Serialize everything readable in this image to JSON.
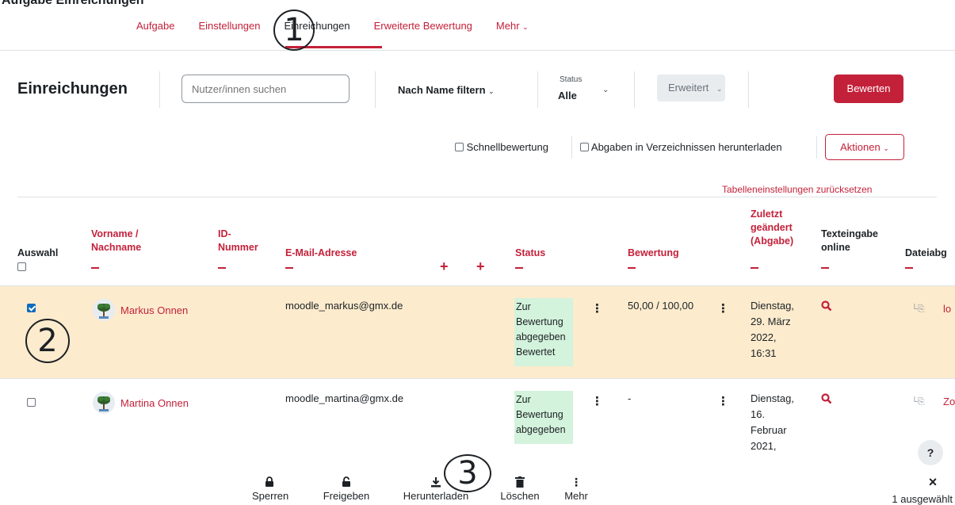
{
  "header_cut": "Aufgabe Einreichungen",
  "tabs": [
    {
      "label": "Aufgabe"
    },
    {
      "label": "Einstellungen"
    },
    {
      "label": "Einreichungen"
    },
    {
      "label": "Erweiterte Bewertung"
    },
    {
      "label": "Mehr"
    }
  ],
  "toolbar": {
    "title": "Einreichungen",
    "search_placeholder": "Nutzer/innen suchen",
    "name_filter": "Nach Name filtern",
    "status_label": "Status",
    "status_value": "Alle",
    "advanced": "Erweitert",
    "grade_button": "Bewerten"
  },
  "options": {
    "quick_grading": "Schnellbewertung",
    "download_folders": "Abgaben in Verzeichnissen herunterladen",
    "actions": "Aktionen",
    "reset_table": "Tabelleneinstellungen zurücksetzen"
  },
  "table": {
    "headers": {
      "select": "Auswahl",
      "name_1": "Vorname /",
      "name_2": "Nachname",
      "id_1": "ID-",
      "id_2": "Nummer",
      "email": "E-Mail-Adresse",
      "status": "Status",
      "grade": "Bewertung",
      "modified_1": "Zuletzt",
      "modified_2": "geändert",
      "modified_3": "(Abgabe)",
      "text_1": "Texteingabe",
      "text_2": "online",
      "file": "Dateiabg"
    },
    "rows": [
      {
        "name": "Markus Onnen",
        "email": "moodle_markus@gmx.de",
        "status_1": "Zur",
        "status_2": "Bewertung",
        "status_3": "abgegeben",
        "status_4": "Bewertet",
        "grade": "50,00 / 100,00",
        "date_1": "Dienstag,",
        "date_2": "29. März",
        "date_3": "2022,",
        "date_4": "16:31",
        "file": "lo"
      },
      {
        "name": "Martina Onnen",
        "email": "moodle_martina@gmx.de",
        "status_1": "Zur",
        "status_2": "Bewertung",
        "status_3": "abgegeben",
        "grade": "-",
        "date_1": "Dienstag,",
        "date_2": "16.",
        "date_3": "Februar",
        "date_4": "2021,",
        "file": "Zo"
      }
    ]
  },
  "bottom_bar": {
    "lock": "Sperren",
    "unlock": "Freigeben",
    "download": "Herunterladen",
    "delete": "Löschen",
    "more": "Mehr",
    "selected": "1 ausgewählt",
    "close": "×"
  },
  "annotations": {
    "one": "1",
    "two": "2",
    "three": "3"
  },
  "help": "?",
  "colors": {
    "accent": "#c3213a",
    "highlight_row": "#fcebcd",
    "status_bg": "#d3f3dc"
  }
}
